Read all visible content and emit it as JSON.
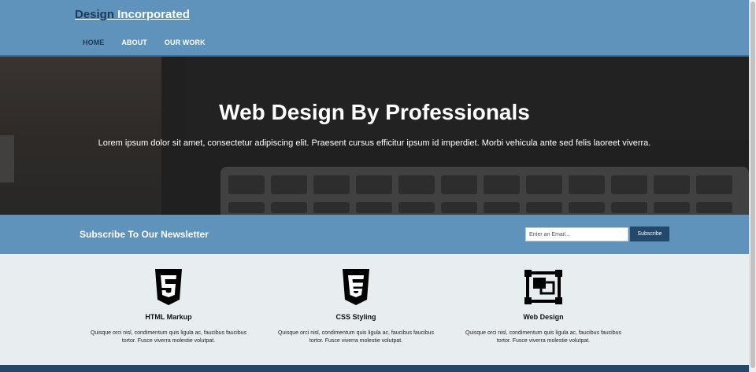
{
  "header": {
    "logo_part1": "Design",
    "logo_part2": " Incorporated",
    "nav": [
      {
        "label": "HOME",
        "active": true
      },
      {
        "label": "ABOUT",
        "active": false
      },
      {
        "label": "OUR WORK",
        "active": false
      }
    ]
  },
  "hero": {
    "title": "Web Design By Professionals",
    "subtitle": "Lorem ipsum dolor sit amet, consectetur adipiscing elit. Praesent cursus efficitur ipsum id imperdiet. Morbi vehicula ante sed felis laoreet viverra."
  },
  "newsletter": {
    "title": "Subscribe To Our Newsletter",
    "email_placeholder": "Enter an Email...",
    "button_label": "Subscribe"
  },
  "features": [
    {
      "icon": "html5-icon",
      "title": "HTML Markup",
      "text": "Quisque orci nisl, condimentum quis ligula ac, faucibus faucibus tortor. Fusce viverra molestie volutpat."
    },
    {
      "icon": "css3-icon",
      "title": "CSS Styling",
      "text": "Quisque orci nisl, condimentum quis ligula ac, faucibus faucibus tortor. Fusce viverra molestie volutpat."
    },
    {
      "icon": "web-design-icon",
      "title": "Web Design",
      "text": "Quisque orci nisl, condimentum quis ligula ac, faucibus faucibus tortor. Fusce viverra molestie volutpat."
    }
  ],
  "colors": {
    "header_bg": "#5f93bb",
    "accent_dark": "#1e3b57",
    "button_bg": "#22486a",
    "features_bg": "#e8eef0"
  }
}
